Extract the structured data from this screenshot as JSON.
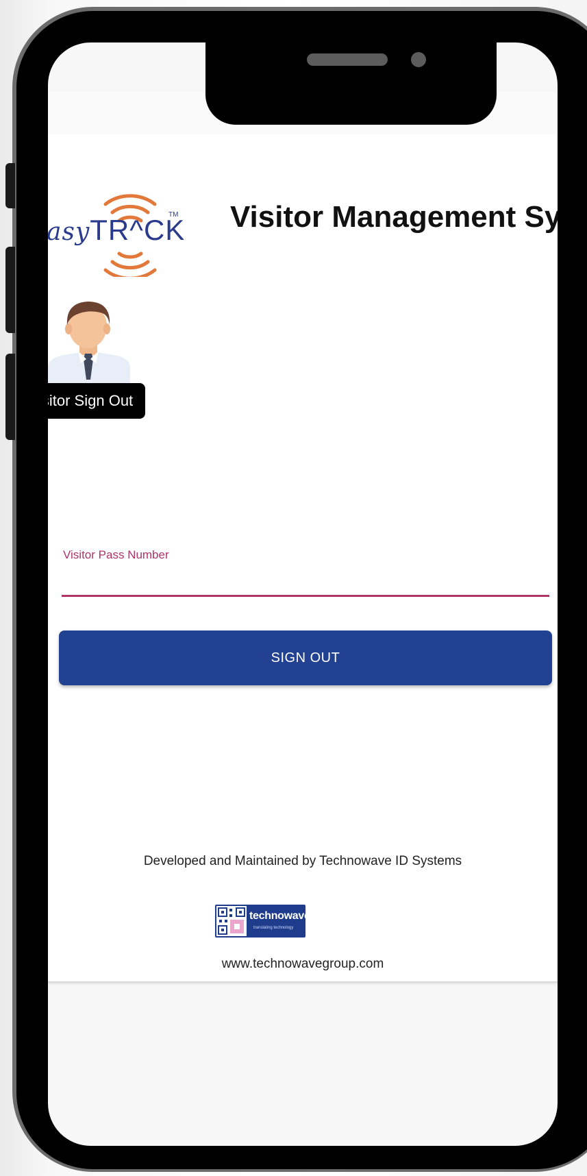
{
  "header": {
    "logo_text_prefix": "asy",
    "logo_text_main": "TR^CK",
    "logo_tm": "TM",
    "title": "Visitor Management Syst"
  },
  "tooltip": {
    "label": "isitor Sign Out"
  },
  "form": {
    "pass_label": "Visitor Pass Number",
    "pass_value": "",
    "signout_label": "SIGN OUT"
  },
  "footer": {
    "developed_by": "Developed and Maintained by Technowave ID Systems",
    "company_logo_name": "technowave",
    "company_logo_tagline": "translating technology",
    "website": "www.technowavegroup.com"
  },
  "colors": {
    "accent": "#b0336a",
    "button": "#224190",
    "logo_orange": "#e2783a",
    "logo_blue": "#2a3a8c"
  },
  "icons": {
    "avatar": "visitor-avatar-icon",
    "signal": "wireless-signal-icon"
  }
}
